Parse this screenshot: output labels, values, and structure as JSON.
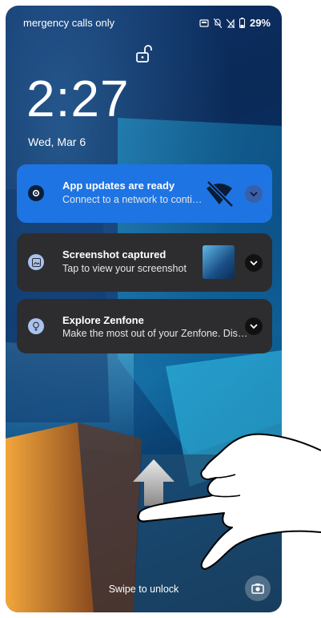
{
  "status_bar": {
    "carrier_text": "mergency calls only",
    "battery": "29%"
  },
  "lockscreen": {
    "time": "2:27",
    "date": "Wed, Mar 6",
    "swipe_hint": "Swipe to unlock"
  },
  "notifications": [
    {
      "title": "App updates are ready",
      "text": "Connect to a network to continue",
      "icon": "gear-icon",
      "background": "#1e74e3"
    },
    {
      "title": "Screenshot captured",
      "text": "Tap to view your screenshot",
      "icon": "image-icon",
      "background": "#2d2d2f"
    },
    {
      "title": "Explore Zenfone",
      "text": "Make the most out of your Zenfone. Disco...",
      "icon": "lightbulb-icon",
      "background": "#2d2d2f"
    }
  ],
  "gesture_overlay": {
    "icons": [
      "up-arrow-icon",
      "hand-pointer-icon"
    ]
  }
}
